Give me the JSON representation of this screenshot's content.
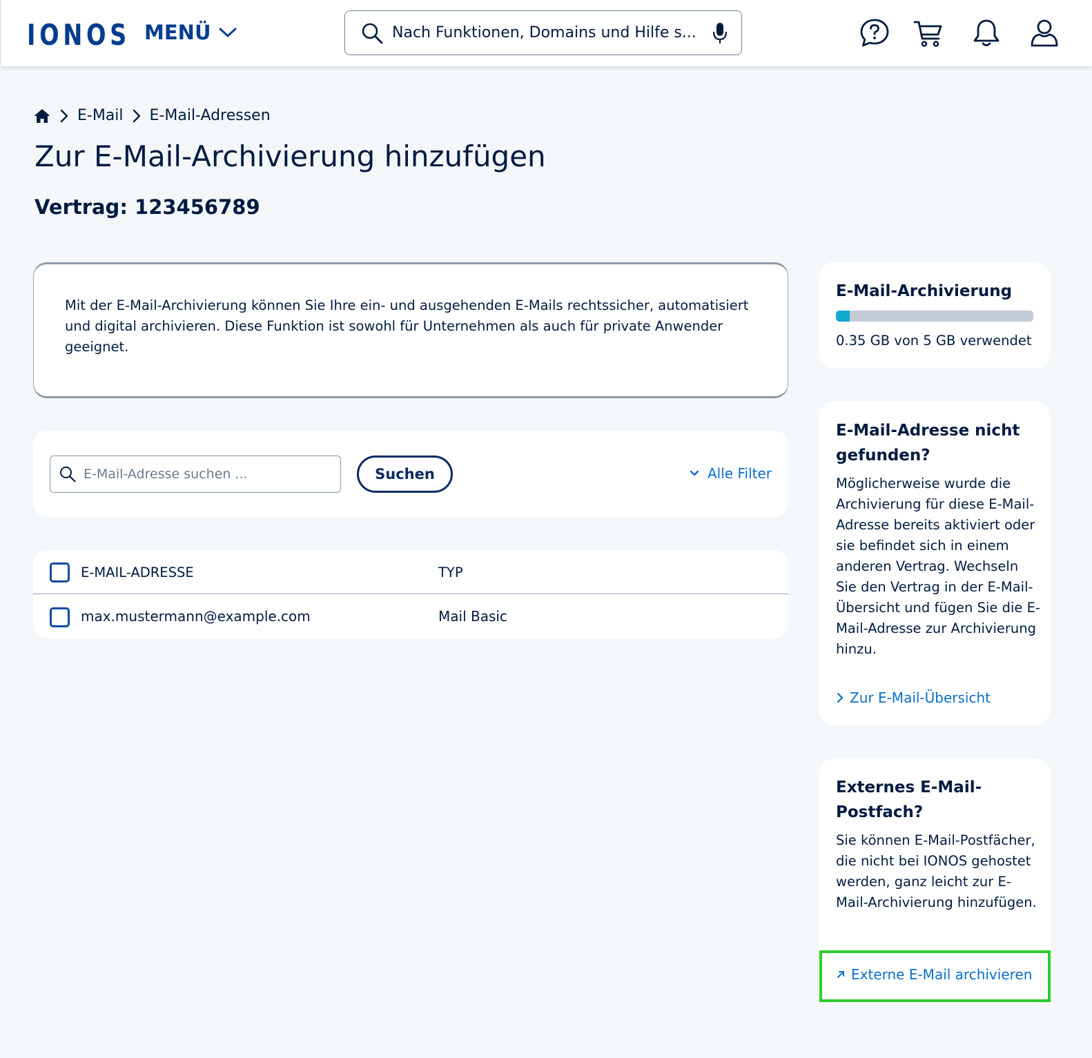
{
  "header": {
    "logo": "IONOS",
    "menu_label": "MENÜ",
    "search_placeholder": "Nach Funktionen, Domains und Hilfe s...",
    "icons": [
      "help-chat-icon",
      "cart-icon",
      "bell-icon",
      "user-icon"
    ]
  },
  "breadcrumb": {
    "home_icon": "home-icon",
    "items": [
      "E-Mail",
      "E-Mail-Adressen"
    ]
  },
  "page": {
    "title": "Zur E-Mail-Archivierung hinzufügen",
    "contract": "Vertrag: 123456789"
  },
  "info": {
    "text": "Mit der E-Mail-Archivierung können Sie Ihre ein- und ausgehenden E-Mails rechtssicher, automatisiert und digital archivieren. Diese Funktion ist sowohl für Unternehmen als auch für private Anwender geeignet."
  },
  "filter": {
    "search_placeholder": "E-Mail-Adresse suchen ...",
    "search_button": "Suchen",
    "all_filters": "Alle Filter"
  },
  "table": {
    "headers": [
      "E-MAIL-ADRESSE",
      "TYP"
    ],
    "rows": [
      {
        "email": "max.mustermann@example.com",
        "type": "Mail Basic"
      }
    ]
  },
  "sidebar": {
    "usage": {
      "title": "E-Mail-Archivierung",
      "used_gb": 0.35,
      "total_gb": 5,
      "text": "0.35 GB von 5 GB verwendet"
    },
    "not_found": {
      "title": "E-Mail-Adresse nicht gefunden?",
      "text": "Möglicherweise wurde die Archivierung für diese E-Mail-Adresse bereits aktiviert oder sie befindet sich in einem anderen Vertrag. Wechseln Sie den Vertrag in der E-Mail-Übersicht und fügen Sie die E-Mail-Adresse zur Archivierung hinzu.",
      "link": "Zur E-Mail-Übersicht"
    },
    "external": {
      "title": "Externes E-Mail-Postfach?",
      "text": "Sie können E-Mail-Postfächer, die nicht bei IONOS gehostet werden, ganz leicht zur E-Mail-Archivierung hinzufügen.",
      "link": "Externe E-Mail archivieren"
    }
  },
  "colors": {
    "brand": "#003d8f",
    "link": "#0b6fc8",
    "progress_fill": "#11a9cf",
    "highlight": "#2ecc2e"
  }
}
